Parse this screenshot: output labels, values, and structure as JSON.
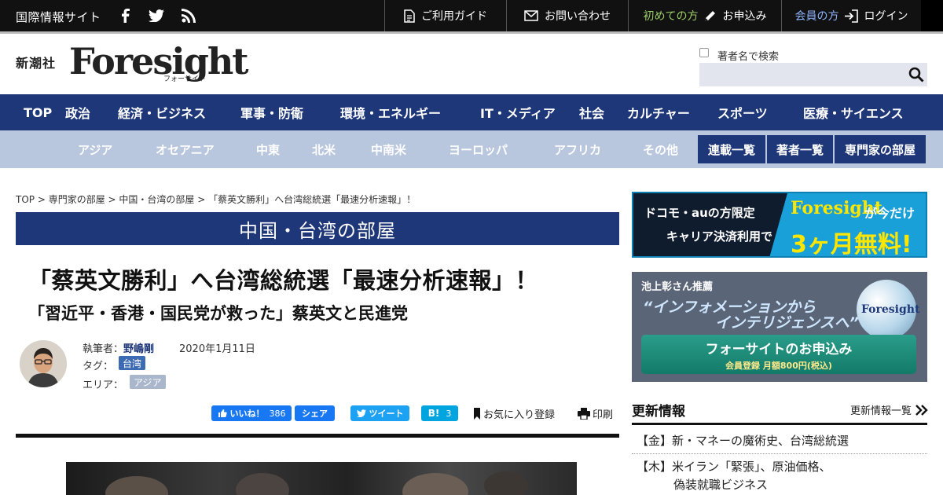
{
  "topbar": {
    "site_name": "国際情報サイト",
    "links": {
      "guide": "ご利用ガイド",
      "contact": "お問い合わせ",
      "first_time": "初めての方",
      "apply": "お申込み",
      "member": "会員の方",
      "login": "ログイン"
    },
    "icons": [
      "facebook-icon",
      "twitter-icon",
      "rss-icon",
      "document-icon",
      "mail-icon",
      "pencil-icon",
      "login-icon"
    ]
  },
  "header": {
    "publisher": "新潮社",
    "logo": "Foresight",
    "logo_sub": "フォーサイト",
    "search_checkbox_label": "著者名で検索",
    "search_placeholder": ""
  },
  "main_nav": [
    "TOP",
    "政治",
    "経済・ビジネス",
    "軍事・防衛",
    "環境・エネルギー",
    "IT・メディア",
    "社会",
    "カルチャー",
    "スポーツ",
    "医療・サイエンス"
  ],
  "sub_nav": [
    "アジア",
    "オセアニア",
    "中東",
    "北米",
    "中南米",
    "ヨーロッパ",
    "アフリカ",
    "その他"
  ],
  "sub_nav_buttons": [
    "連載一覧",
    "著者一覧",
    "専門家の部屋"
  ],
  "breadcrumb": "TOP > 専門家の部屋 > 中国・台湾の部屋 > 「蔡英文勝利」へ台湾総統選「最速分析速報」！",
  "article": {
    "room": "中国・台湾の部屋",
    "title": "「蔡英文勝利」へ台湾総統選「最速分析速報」！",
    "subtitle": "「習近平・香港・国民党が救った」蔡英文と民進党",
    "author_label": "執筆者：",
    "author": "野嶋剛",
    "date": "2020年1月11日",
    "tag_label": "タグ：",
    "tag": "台湾",
    "area_label": "エリア：",
    "area": "アジア",
    "share": {
      "like": "いいね！",
      "like_count": "386",
      "share": "シェア",
      "tweet": "ツイート",
      "hatena": "B!",
      "hatena_count": "3",
      "favorite": "お気に入り登録",
      "print": "印刷"
    }
  },
  "sidebar": {
    "ad1": {
      "line1": "ドコモ・auの方限定",
      "line2": "キャリア決済利用で",
      "brand": "Foresight",
      "tail": "が今だけ",
      "offer": "3ヶ月無料!"
    },
    "ad2": {
      "recommend": "池上彰さん推薦",
      "quote1": "“インフォメーションから",
      "quote2": "インテリジェンスへ”",
      "globe": "Foresight",
      "button": "フォーサイトのお申込み",
      "button_sub": "会員登録 月額800円(税込)"
    },
    "updates": {
      "title": "更新情報",
      "more": "更新情報一覧",
      "items": [
        {
          "day": "【金】",
          "text": "新・マネーの魔術史、台湾総統選"
        },
        {
          "day": "【木】",
          "text": "米イラン「緊張」、原油価格、"
        },
        {
          "day": "",
          "text": "偽装就職ビジネス"
        }
      ]
    }
  },
  "colors": {
    "navy": "#1e3778",
    "light_nav": "#b8c6de",
    "facebook": "#1877f2",
    "twitter": "#1da1f2",
    "hatena": "#00a4de",
    "tag_blue": "#3d6bb3",
    "tag_gray": "#a9b6cc"
  }
}
